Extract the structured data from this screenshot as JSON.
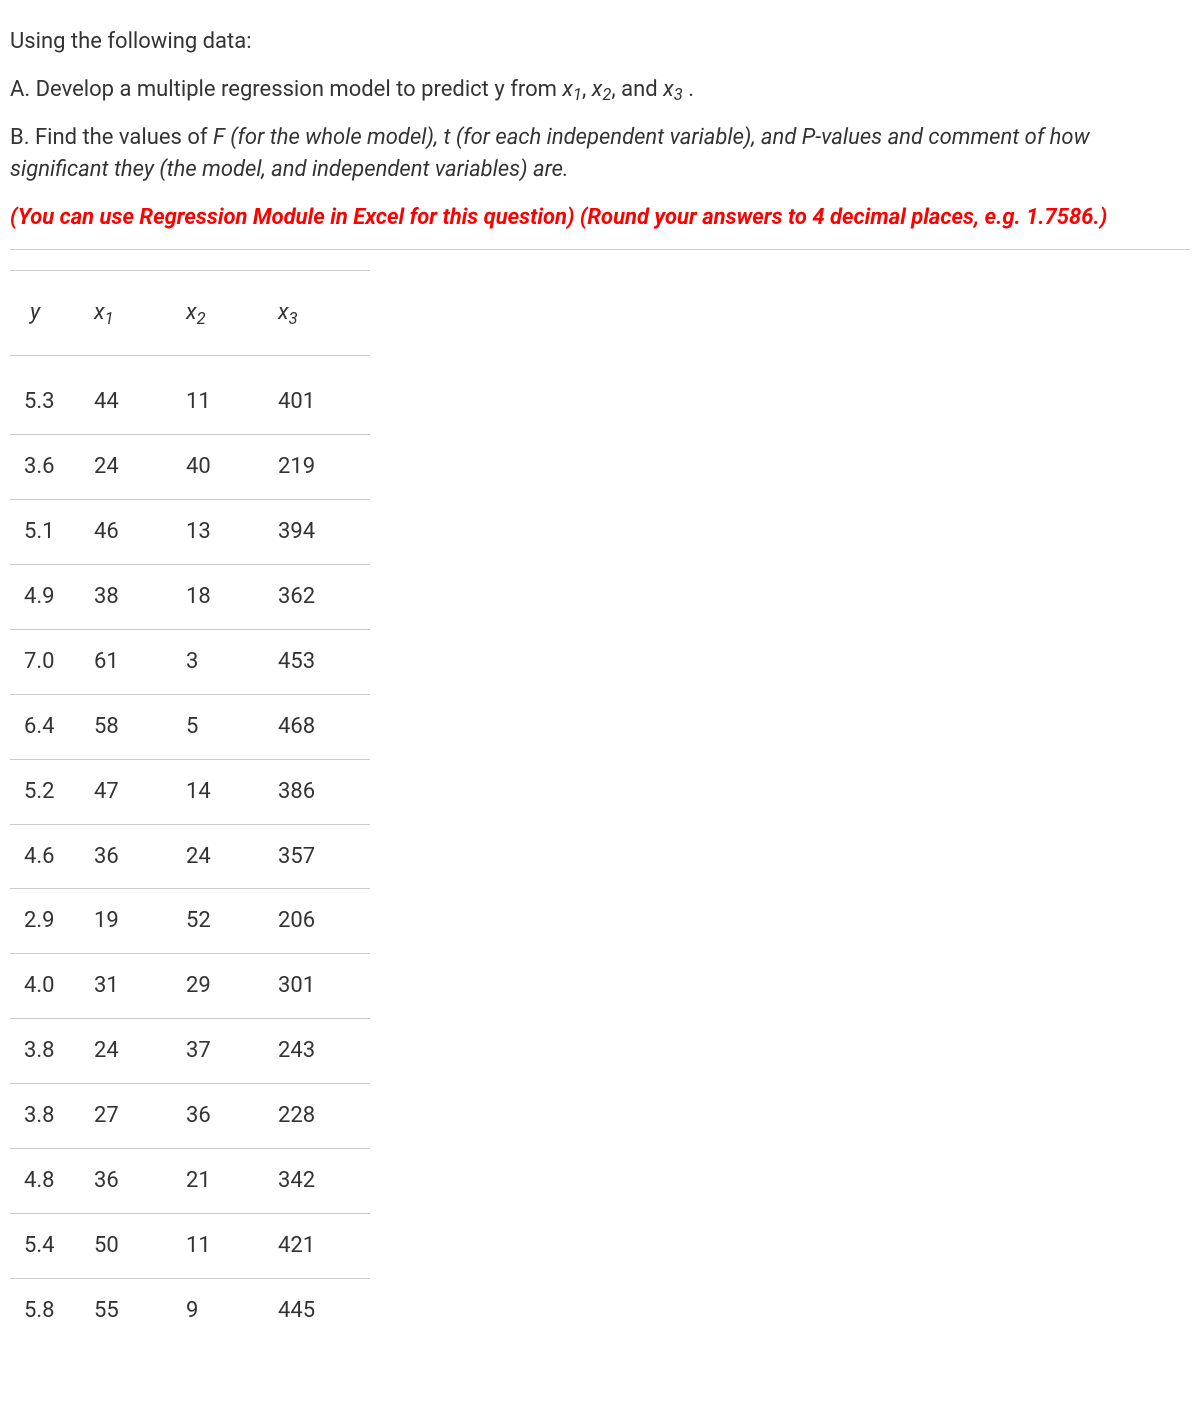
{
  "intro": {
    "line1": "Using the following data:",
    "partA_prefix": "A. Develop a multiple regression model to predict y from ",
    "partA_suffix": " .",
    "x1": "x",
    "x1_sub": "1",
    "x2": "x",
    "x2_sub": "2",
    "x3": "x",
    "x3_sub": "3",
    "comma1": ", ",
    "comma2": ", and ",
    "partB_plain": "B. Find the values of ",
    "partB_italic": "F (for the whole model), t (for each independent variable), and P-values and comment of how significant they (the model, and independent variables) are.",
    "note": "(You can use Regression Module in Excel for this question) (Round your answers to 4 decimal places, e.g. 1.7586.)"
  },
  "table": {
    "headers": {
      "y": "y",
      "x1": "x",
      "x1_sub": "1",
      "x2": "x",
      "x2_sub": "2",
      "x3": "x",
      "x3_sub": "3"
    },
    "rows": [
      {
        "y": "5.3",
        "x1": "44",
        "x2": "11",
        "x3": "401"
      },
      {
        "y": "3.6",
        "x1": "24",
        "x2": "40",
        "x3": "219"
      },
      {
        "y": "5.1",
        "x1": "46",
        "x2": "13",
        "x3": "394"
      },
      {
        "y": "4.9",
        "x1": "38",
        "x2": "18",
        "x3": "362"
      },
      {
        "y": "7.0",
        "x1": "61",
        "x2": "3",
        "x3": "453"
      },
      {
        "y": "6.4",
        "x1": "58",
        "x2": "5",
        "x3": "468"
      },
      {
        "y": "5.2",
        "x1": "47",
        "x2": "14",
        "x3": "386"
      },
      {
        "y": "4.6",
        "x1": "36",
        "x2": "24",
        "x3": "357"
      },
      {
        "y": "2.9",
        "x1": "19",
        "x2": "52",
        "x3": "206"
      },
      {
        "y": "4.0",
        "x1": "31",
        "x2": "29",
        "x3": "301"
      },
      {
        "y": "3.8",
        "x1": "24",
        "x2": "37",
        "x3": "243"
      },
      {
        "y": "3.8",
        "x1": "27",
        "x2": "36",
        "x3": "228"
      },
      {
        "y": "4.8",
        "x1": "36",
        "x2": "21",
        "x3": "342"
      },
      {
        "y": "5.4",
        "x1": "50",
        "x2": "11",
        "x3": "421"
      },
      {
        "y": "5.8",
        "x1": "55",
        "x2": "9",
        "x3": "445"
      }
    ]
  }
}
